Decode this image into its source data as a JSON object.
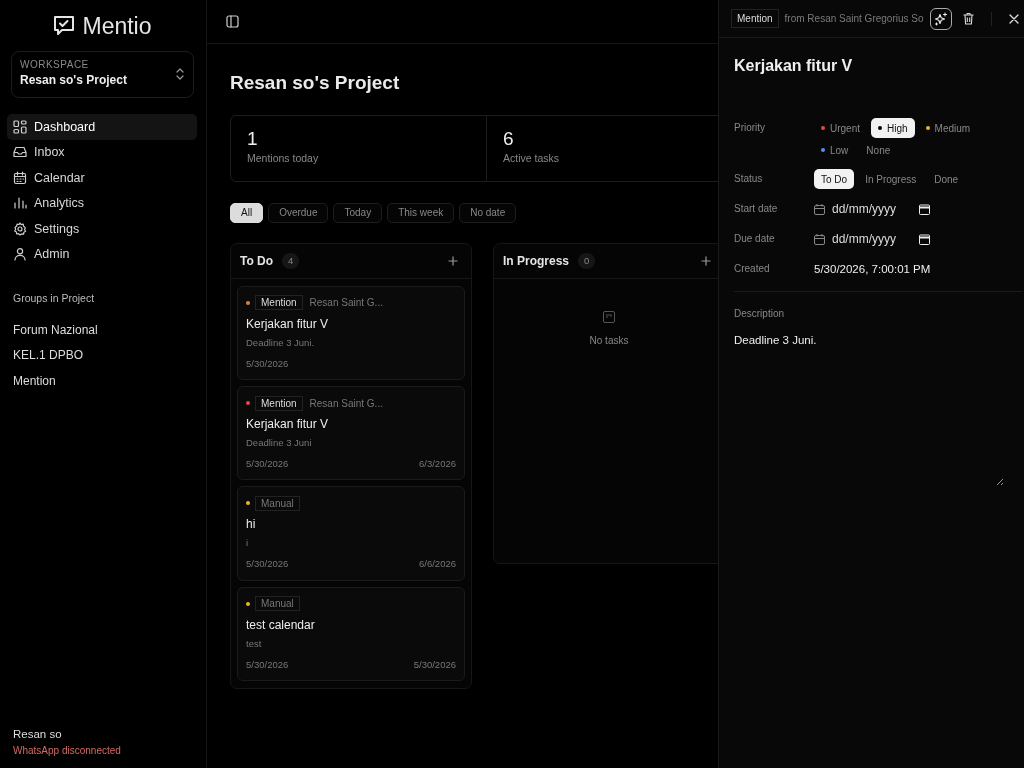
{
  "brand": "Mentio",
  "workspace": {
    "label": "WORKSPACE",
    "name": "Resan so's Project"
  },
  "nav": [
    {
      "label": "Dashboard",
      "selected": true
    },
    {
      "label": "Inbox",
      "selected": false
    },
    {
      "label": "Calendar",
      "selected": false
    },
    {
      "label": "Analytics",
      "selected": false
    },
    {
      "label": "Settings",
      "selected": false
    },
    {
      "label": "Admin",
      "selected": false
    }
  ],
  "groups": {
    "heading": "Groups in Project",
    "items": [
      "Forum Nazional",
      "KEL.1 DPBO",
      "Mention"
    ]
  },
  "user": {
    "name": "Resan so",
    "status": "WhatsApp disconnected"
  },
  "page_title": "Resan so's Project",
  "stats": [
    {
      "value": "1",
      "label": "Mentions today"
    },
    {
      "value": "6",
      "label": "Active tasks"
    }
  ],
  "filters": [
    {
      "label": "All",
      "selected": true
    },
    {
      "label": "Overdue",
      "selected": false
    },
    {
      "label": "Today",
      "selected": false
    },
    {
      "label": "This week",
      "selected": false
    },
    {
      "label": "No date",
      "selected": false
    }
  ],
  "board_columns": [
    {
      "title": "To Do",
      "count": "4",
      "cards": [
        {
          "color": "#e0813a",
          "source": "Mention",
          "sender": "Resan Saint G...",
          "title": "Kerjakan fitur V",
          "description": "Deadline 3 Juni.",
          "created": "5/30/2026"
        },
        {
          "color": "#e5483f",
          "source": "Mention",
          "sender": "Resan Saint G...",
          "title": "Kerjakan fitur V",
          "description": "Deadline 3 Juni",
          "created": "5/30/2026",
          "due": "6/3/2026"
        },
        {
          "color": "#e9b824",
          "source": "Manual",
          "title": "hi",
          "description": "i",
          "created": "5/30/2026",
          "due": "6/6/2026"
        },
        {
          "color": "#e9b824",
          "source": "Manual",
          "title": "test calendar",
          "description": "test",
          "created": "5/30/2026",
          "due": "5/30/2026"
        }
      ]
    },
    {
      "title": "In Progress",
      "count": "0",
      "empty_text": "No tasks"
    }
  ],
  "detail": {
    "source": "Mention",
    "sender": "from Resan Saint Gregorius So",
    "title": "Kerjakan fitur V",
    "priority": {
      "label": "Priority",
      "options": [
        {
          "label": "Urgent",
          "color": "#e5483f",
          "selected": false
        },
        {
          "label": "High",
          "color": "#000000",
          "selected": true
        },
        {
          "label": "Medium",
          "color": "#e9b824",
          "selected": false
        },
        {
          "label": "Low",
          "color": "#5b8def",
          "selected": false
        },
        {
          "label": "None",
          "selected": false
        }
      ]
    },
    "status": {
      "label": "Status",
      "options": [
        {
          "label": "To Do",
          "selected": true
        },
        {
          "label": "In Progress",
          "selected": false
        },
        {
          "label": "Done",
          "selected": false
        }
      ]
    },
    "dates": [
      {
        "label": "Start date",
        "placeholder": "dd/mm/yyyy"
      },
      {
        "label": "Due date",
        "placeholder": "dd/mm/yyyy"
      }
    ],
    "created": {
      "label": "Created",
      "value": "5/30/2026, 7:00:01 PM"
    },
    "description": {
      "label": "Description",
      "value": "Deadline 3 Juni."
    }
  }
}
